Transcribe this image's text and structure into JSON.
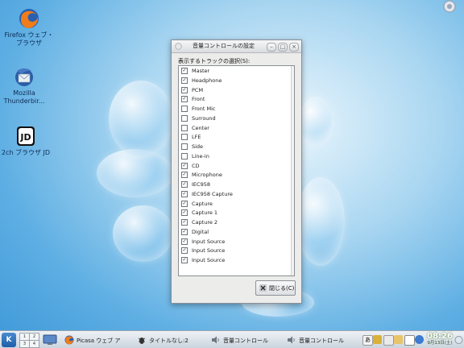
{
  "desktop": {
    "icons": [
      {
        "label": "Firefox ウェブ・\nブラウザ",
        "icon": "firefox-icon"
      },
      {
        "label": "Mozilla\nThunderbir...",
        "icon": "thunderbird-icon"
      },
      {
        "label": "2ch ブラウザ JD",
        "icon": "jd-browser-icon"
      }
    ]
  },
  "dialog": {
    "title": "音量コントロールの設定",
    "selection_label": "表示するトラックの選択(S):",
    "tracks": [
      {
        "name": "Master",
        "checked": true
      },
      {
        "name": "Headphone",
        "checked": true
      },
      {
        "name": "PCM",
        "checked": true
      },
      {
        "name": "Front",
        "checked": true
      },
      {
        "name": "Front Mic",
        "checked": false
      },
      {
        "name": "Surround",
        "checked": false
      },
      {
        "name": "Center",
        "checked": false
      },
      {
        "name": "LFE",
        "checked": false
      },
      {
        "name": "Side",
        "checked": false
      },
      {
        "name": "Line-in",
        "checked": false
      },
      {
        "name": "CD",
        "checked": true
      },
      {
        "name": "Microphone",
        "checked": true
      },
      {
        "name": "IEC958",
        "checked": true
      },
      {
        "name": "IEC958 Capture",
        "checked": true
      },
      {
        "name": "Capture",
        "checked": true
      },
      {
        "name": "Capture 1",
        "checked": true
      },
      {
        "name": "Capture 2",
        "checked": true
      },
      {
        "name": "Digital",
        "checked": true
      },
      {
        "name": "Input Source",
        "checked": true
      },
      {
        "name": "Input Source",
        "checked": true
      },
      {
        "name": "Input Source",
        "checked": true
      }
    ],
    "close_label": "閉じる(C)"
  },
  "taskbar": {
    "pager": [
      "1",
      "2",
      "3",
      "4"
    ],
    "tasks": [
      {
        "label": "Picasa ウェブ ア",
        "icon": "firefox-icon"
      },
      {
        "label": "タイトルなし:2",
        "icon": "bug-icon"
      },
      {
        "label": "音量コントロール",
        "icon": "speaker-icon"
      },
      {
        "label": "音量コントロール",
        "icon": "speaker-icon"
      }
    ],
    "clock_time": "08:26",
    "clock_date": "9月13日(土)"
  },
  "colors": {
    "desktop_blue": "#5daee3",
    "kde_blue": "#1d5ea8",
    "clock_green": "#3a6e2a"
  }
}
